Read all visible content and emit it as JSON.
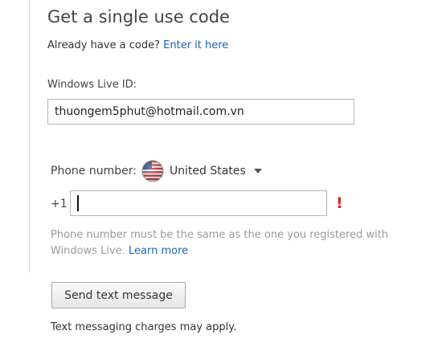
{
  "form": {
    "title": "Get a single use code",
    "have_code_text": "Already have a code?",
    "enter_code_link": "Enter it here",
    "live_id_label": "Windows Live ID:",
    "live_id_value": "thuongem5phut@hotmail.com.vn",
    "phone_label": "Phone number:",
    "country": {
      "name": "United States",
      "flag_icon": "us-flag-icon",
      "dropdown_icon": "chevron-down-icon"
    },
    "country_code": "+1",
    "phone_value": "",
    "error_marker": "!",
    "error_icon": "exclamation-icon",
    "hint_text": "Phone number must be the same as the one you registered with Windows Live.",
    "learn_more_link": "Learn more",
    "send_button_label": "Send text message",
    "charges_note": "Text messaging charges may apply."
  },
  "colors": {
    "link": "#1e63b3",
    "error": "#e0241b",
    "hint": "#9a9a9a"
  }
}
